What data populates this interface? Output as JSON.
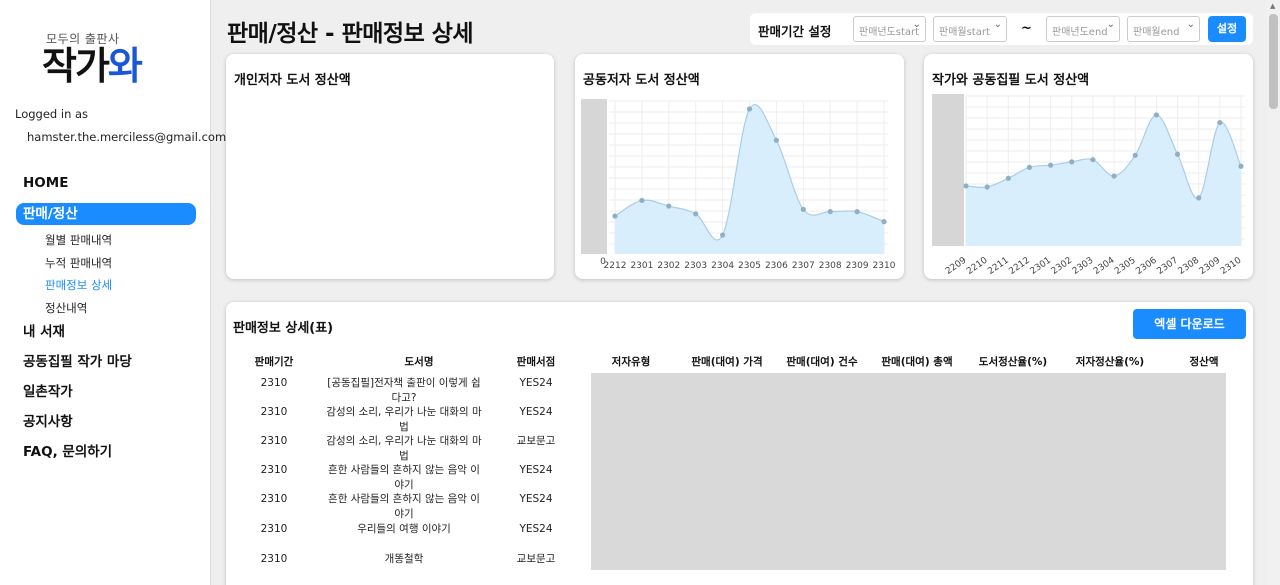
{
  "brand": {
    "sub": "모두의 출판사",
    "main_a": "작가",
    "main_b": "와"
  },
  "login": {
    "label": "Logged in as",
    "email": "hamster.the.merciless@gmail.com"
  },
  "nav": {
    "home": "HOME",
    "sales": "판매/정산",
    "sub": [
      "월별 판매내역",
      "누적 판매내역",
      "판매정보 상세",
      "정산내역"
    ],
    "library": "내 서재",
    "joint": "공동집필 작가 마당",
    "writers": "일촌작가",
    "notice": "공지사항",
    "faq": "FAQ, 문의하기"
  },
  "page_title": "판매/정산 - 판매정보 상세",
  "period": {
    "label": "판매기간 설정",
    "year_start": "판매년도start",
    "month_start": "판매월start",
    "tilde": "~",
    "year_end": "판매년도end",
    "month_end": "판매월end",
    "set_button": "설정"
  },
  "cards": {
    "personal": "개인저자 도서 정산액",
    "coauthor": "공동저자 도서 정산액",
    "joint": "작가와 공동집필 도서 정산액"
  },
  "chart_data": [
    {
      "type": "area",
      "title": "공동저자 도서 정산액",
      "x": [
        "2212",
        "2301",
        "2302",
        "2303",
        "2304",
        "2305",
        "2306",
        "2307",
        "2308",
        "2309",
        "2310"
      ],
      "values": [
        34,
        48,
        43,
        36,
        17,
        130,
        102,
        40,
        38,
        38,
        29
      ],
      "y_tick_label": "0",
      "color": "#a9cde6"
    },
    {
      "type": "area",
      "title": "작가와 공동집필 도서 정산액",
      "x": [
        "2209",
        "2210",
        "2211",
        "2212",
        "2301",
        "2302",
        "2303",
        "2304",
        "2305",
        "2306",
        "2307",
        "2308",
        "2309",
        "2310"
      ],
      "values": [
        55,
        54,
        62,
        72,
        74,
        77,
        79,
        64,
        83,
        120,
        84,
        44,
        113,
        73
      ],
      "color": "#a9cde6"
    }
  ],
  "table": {
    "title": "판매정보 상세(표)",
    "excel_button": "엑셀 다운로드",
    "headers": [
      "판매기간",
      "도서명",
      "판매서점",
      "저자유형",
      "판매(대여) 가격",
      "판매(대여) 건수",
      "판매(대여) 총액",
      "도서정산율(%)",
      "저자정산율(%)",
      "정산액"
    ],
    "rows": [
      {
        "period": "2310",
        "title1": "[공동집필]전자책 출판이 이렇게 쉽",
        "title2": "다고?",
        "store": "YES24"
      },
      {
        "period": "2310",
        "title1": "감성의 소리, 우리가 나눈 대화의 마",
        "title2": "법",
        "store": "YES24"
      },
      {
        "period": "2310",
        "title1": "감성의 소리, 우리가 나눈 대화의 마",
        "title2": "법",
        "store": "교보문고"
      },
      {
        "period": "2310",
        "title1": "흔한 사람들의 흔하지 않는 음악 이",
        "title2": "야기",
        "store": "YES24"
      },
      {
        "period": "2310",
        "title1": "흔한 사람들의 흔하지 않는 음악 이",
        "title2": "야기",
        "store": "YES24"
      },
      {
        "period": "2310",
        "title1": "우리들의 여행 이야기",
        "title2": "",
        "store": "YES24"
      },
      {
        "period": "2310",
        "title1": "개똥철학",
        "title2": "",
        "store": "교보문고"
      }
    ]
  }
}
